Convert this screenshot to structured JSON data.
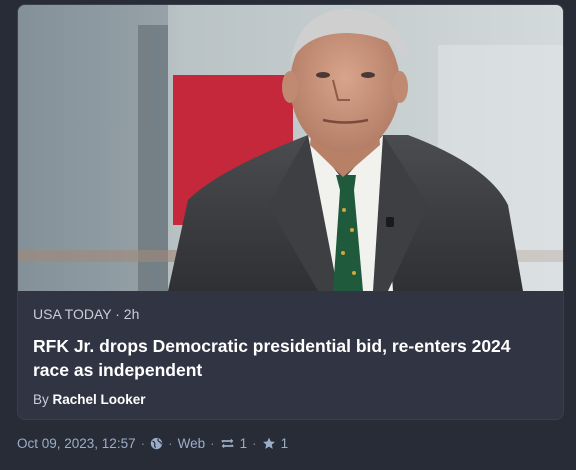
{
  "card": {
    "source": "USA TODAY",
    "age": "2h",
    "title": "RFK Jr. drops Democratic presidential bid, re-enters 2024 race as independent",
    "byline_prefix": "By",
    "author": "Rachel Looker",
    "image_icon": "news-photo"
  },
  "meta": {
    "timestamp": "Oct 09, 2023, 12:57",
    "visibility_icon": "globe-icon",
    "app": "Web",
    "boosts": "1",
    "favourites": "1"
  },
  "colors": {
    "background": "#282c37",
    "card": "#313543",
    "meta_text": "#9baec8"
  }
}
